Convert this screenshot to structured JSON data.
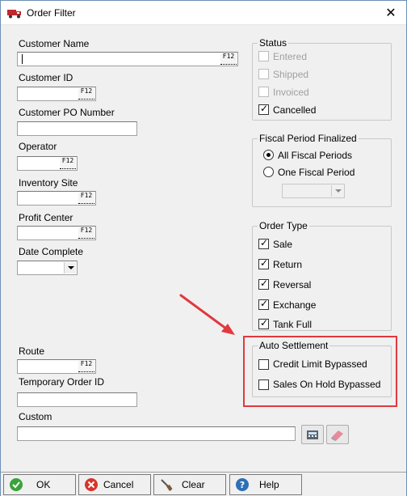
{
  "window": {
    "title": "Order Filter",
    "close_glyph": "✕"
  },
  "left": {
    "customer_name": {
      "label": "Customer Name",
      "value": "",
      "key_hint": "F12"
    },
    "customer_id": {
      "label": "Customer ID",
      "value": "",
      "key_hint": "F12"
    },
    "customer_po_number": {
      "label": "Customer PO Number",
      "value": ""
    },
    "operator": {
      "label": "Operator",
      "value": "",
      "key_hint": "F12"
    },
    "inventory_site": {
      "label": "Inventory Site",
      "value": "",
      "key_hint": "F12"
    },
    "profit_center": {
      "label": "Profit Center",
      "value": "",
      "key_hint": "F12"
    },
    "date_complete": {
      "label": "Date Complete",
      "value": ""
    },
    "route": {
      "label": "Route",
      "value": "",
      "key_hint": "F12"
    },
    "temporary_order_id": {
      "label": "Temporary Order ID",
      "value": ""
    },
    "custom": {
      "label": "Custom",
      "value": ""
    }
  },
  "status": {
    "title": "Status",
    "items": [
      {
        "label": "Entered",
        "checked": false,
        "enabled": false
      },
      {
        "label": "Shipped",
        "checked": false,
        "enabled": false
      },
      {
        "label": "Invoiced",
        "checked": false,
        "enabled": false
      },
      {
        "label": "Cancelled",
        "checked": true,
        "enabled": true
      }
    ]
  },
  "fiscal_period": {
    "title": "Fiscal Period Finalized",
    "options": [
      {
        "label": "All Fiscal Periods",
        "selected": true
      },
      {
        "label": "One Fiscal Period",
        "selected": false
      }
    ],
    "period_select_value": ""
  },
  "order_type": {
    "title": "Order Type",
    "items": [
      {
        "label": "Sale",
        "checked": true
      },
      {
        "label": "Return",
        "checked": true
      },
      {
        "label": "Reversal",
        "checked": true
      },
      {
        "label": "Exchange",
        "checked": true
      },
      {
        "label": "Tank Full",
        "checked": true
      }
    ]
  },
  "auto_settlement": {
    "title": "Auto Settlement",
    "items": [
      {
        "label": "Credit Limit Bypassed",
        "checked": false
      },
      {
        "label": "Sales On Hold Bypassed",
        "checked": false
      }
    ]
  },
  "footer": {
    "ok": "OK",
    "cancel": "Cancel",
    "clear": "Clear",
    "help": "Help"
  },
  "colors": {
    "highlight": "#e0393e",
    "ok_icon": "#3aa33a",
    "cancel_icon": "#d9342b",
    "help_icon": "#2f6fb6"
  }
}
